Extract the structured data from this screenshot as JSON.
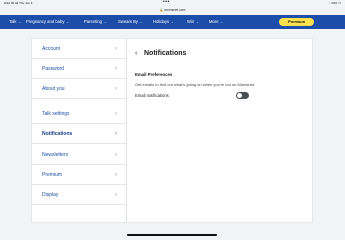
{
  "status": {
    "carrier_time": "iPad  00:34  Thu Jun 4",
    "battery": "29%"
  },
  "browser": {
    "url": "mumsnet.com"
  },
  "nav": {
    "items": [
      {
        "label": "Talk"
      },
      {
        "label": "Pregnancy and baby"
      },
      {
        "label": "Parenting"
      },
      {
        "label": "Swears By"
      },
      {
        "label": "Holidays"
      },
      {
        "label": "Win"
      },
      {
        "label": "More"
      }
    ],
    "premium_label": "Premium"
  },
  "sidebar": {
    "items": [
      {
        "label": "Account"
      },
      {
        "label": "Password"
      },
      {
        "label": "About you"
      },
      {
        "label": "Talk settings"
      },
      {
        "label": "Notifications",
        "active": true
      },
      {
        "label": "Newsletters"
      },
      {
        "label": "Premium"
      },
      {
        "label": "Display"
      }
    ]
  },
  "page": {
    "title": "Notifications",
    "section_title": "Email Preferences",
    "section_description": "Get emails to find out what's going on when you're not on Mumsnet.",
    "toggle_label": "Email notifications",
    "toggle_on": false
  },
  "colors": {
    "nav_blue": "#1c4da8",
    "premium_yellow": "#ffe14d",
    "link_blue": "#1d4fa6"
  }
}
